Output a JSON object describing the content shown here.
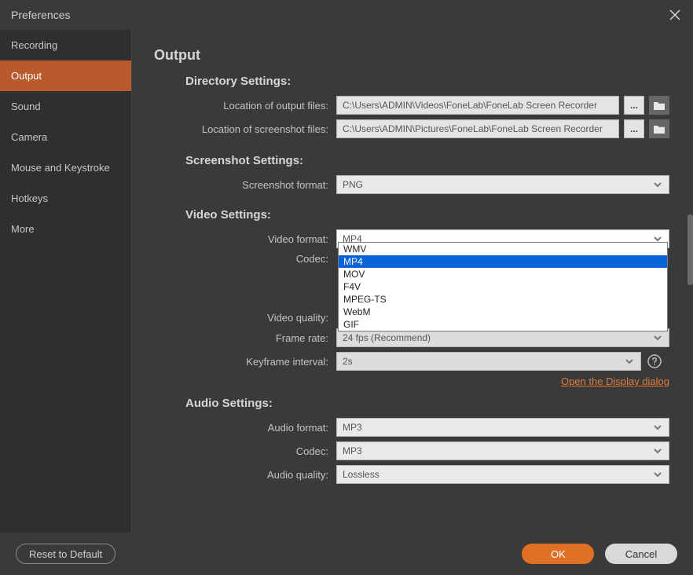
{
  "window": {
    "title": "Preferences"
  },
  "sidebar": {
    "items": [
      {
        "label": "Recording"
      },
      {
        "label": "Output"
      },
      {
        "label": "Sound"
      },
      {
        "label": "Camera"
      },
      {
        "label": "Mouse and Keystroke"
      },
      {
        "label": "Hotkeys"
      },
      {
        "label": "More"
      }
    ],
    "activeIndex": 1
  },
  "page": {
    "title": "Output",
    "directory": {
      "heading": "Directory Settings:",
      "outputLabel": "Location of output files:",
      "outputPath": "C:\\Users\\ADMIN\\Videos\\FoneLab\\FoneLab Screen Recorder",
      "screenshotLabel": "Location of screenshot files:",
      "screenshotPath": "C:\\Users\\ADMIN\\Pictures\\FoneLab\\FoneLab Screen Recorder",
      "ellipsis": "..."
    },
    "screenshot": {
      "heading": "Screenshot Settings:",
      "formatLabel": "Screenshot format:",
      "formatValue": "PNG"
    },
    "video": {
      "heading": "Video Settings:",
      "formatLabel": "Video format:",
      "formatValue": "MP4",
      "formatOptions": [
        "WMV",
        "MP4",
        "MOV",
        "F4V",
        "MPEG-TS",
        "WebM",
        "GIF"
      ],
      "formatSelected": "MP4",
      "codecLabel": "Codec:",
      "qualityLabel": "Video quality:",
      "frameRateLabel": "Frame rate:",
      "frameRateValue": "24 fps (Recommend)",
      "keyframeLabel": "Keyframe interval:",
      "keyframeValue": "2s",
      "displayLink": "Open the Display dialog"
    },
    "audio": {
      "heading": "Audio Settings:",
      "formatLabel": "Audio format:",
      "formatValue": "MP3",
      "codecLabel": "Codec:",
      "codecValue": "MP3",
      "qualityLabel": "Audio quality:",
      "qualityValue": "Lossless"
    }
  },
  "footer": {
    "reset": "Reset to Default",
    "ok": "OK",
    "cancel": "Cancel"
  }
}
